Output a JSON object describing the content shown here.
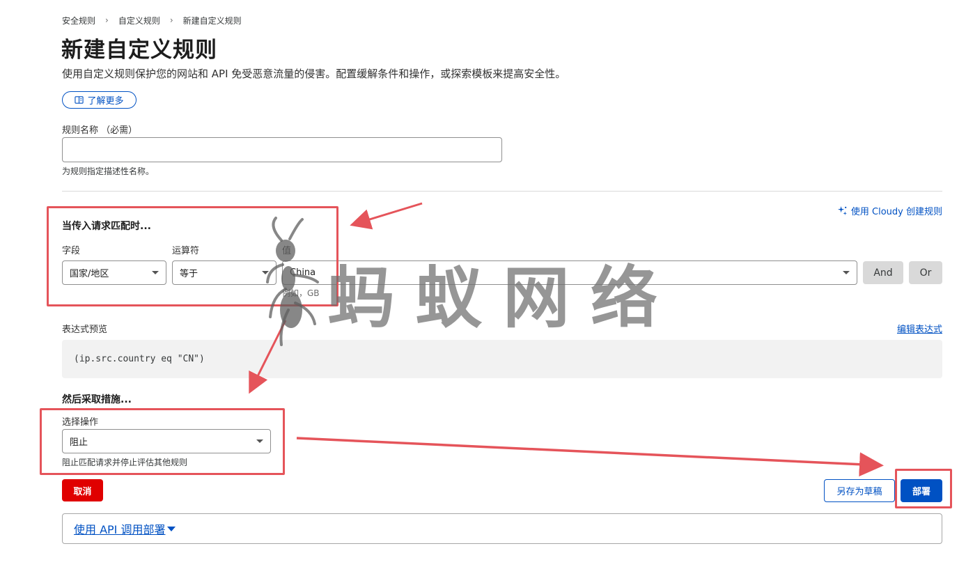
{
  "breadcrumb": [
    "安全规则",
    "自定义规则",
    "新建自定义规则"
  ],
  "breadcrumb_sep": "›",
  "page": {
    "title": "新建自定义规则",
    "description": "使用自定义规则保护您的网站和 API 免受恶意流量的侵害。配置缓解条件和操作，或探索模板来提高安全性。",
    "learn_more": "了解更多"
  },
  "rule_name": {
    "label": "规则名称 （必需）",
    "value": "",
    "helper": "为规则指定描述性名称。"
  },
  "cloudy_link": "使用 Cloudy 创建规则",
  "when": {
    "heading": "当传入请求匹配时...",
    "field_label": "字段",
    "field_value": "国家/地区",
    "operator_label": "运算符",
    "operator_value": "等于",
    "value_label": "值",
    "value_value": "China",
    "value_helper": "例如，GB",
    "and_label": "And",
    "or_label": "Or"
  },
  "expression": {
    "label": "表达式预览",
    "edit_link": "编辑表达式",
    "text": "(ip.src.country eq \"CN\")"
  },
  "then": {
    "heading": "然后采取措施...",
    "action_label": "选择操作",
    "action_value": "阻止",
    "action_helper": "阻止匹配请求并停止评估其他规则"
  },
  "buttons": {
    "cancel": "取消",
    "save_draft": "另存为草稿",
    "deploy": "部署"
  },
  "api_deploy": "使用 API 调用部署",
  "watermark": "蚂蚁网络",
  "colors": {
    "accent": "#0051c3",
    "danger": "#e00000",
    "annotation": "#e5545a"
  }
}
